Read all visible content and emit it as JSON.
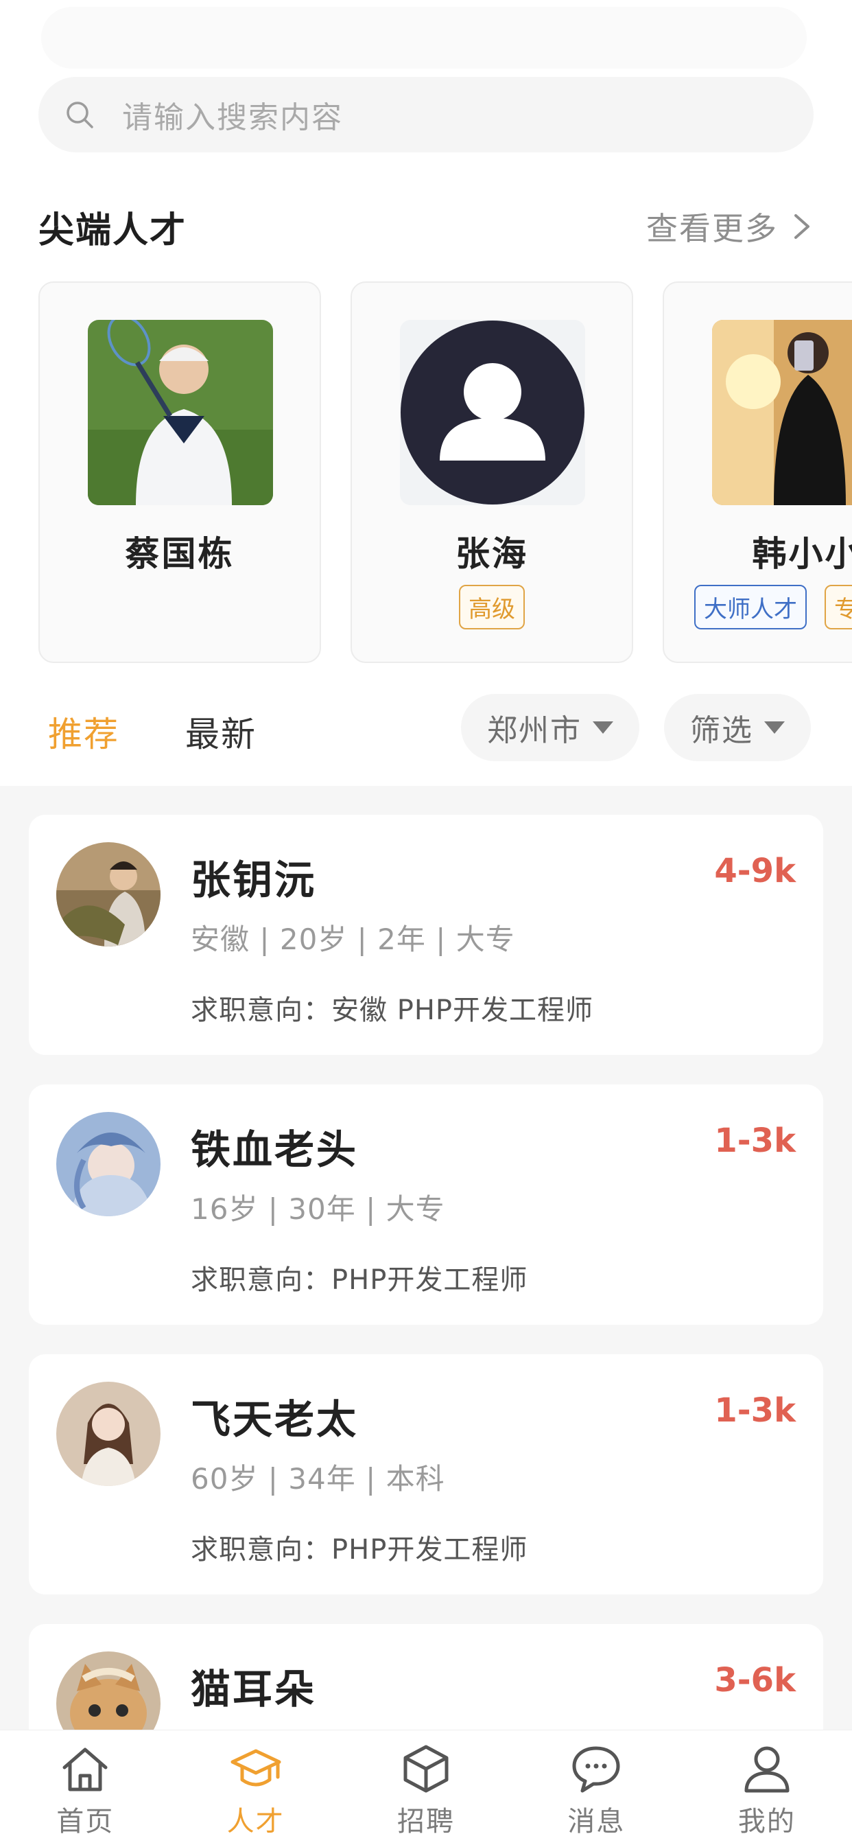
{
  "search": {
    "placeholder": "请输入搜索内容"
  },
  "talent_section": {
    "title": "尖端人才",
    "see_more": "查看更多",
    "cards": [
      {
        "name": "蔡国栋",
        "tags": []
      },
      {
        "name": "张海",
        "tags": [
          "高级"
        ]
      },
      {
        "name": "韩小小",
        "tags": [
          "大师人才",
          "专"
        ]
      }
    ]
  },
  "filters": {
    "tabs": [
      "推荐",
      "最新"
    ],
    "active_tab": "推荐",
    "city": "郑州市",
    "filter_label": "筛选"
  },
  "candidates": [
    {
      "name": "张钥沅",
      "salary": "4-9k",
      "meta": "安徽 | 20岁 | 2年 | 大专",
      "intent": "求职意向：安徽 PHP开发工程师"
    },
    {
      "name": "铁血老头",
      "salary": "1-3k",
      "meta": "16岁 | 30年 | 大专",
      "intent": "求职意向：PHP开发工程师"
    },
    {
      "name": "飞天老太",
      "salary": "1-3k",
      "meta": "60岁 | 34年 | 本科",
      "intent": "求职意向：PHP开发工程师"
    },
    {
      "name": "猫耳朵",
      "salary": "3-6k",
      "meta": "",
      "intent": ""
    }
  ],
  "tabbar": {
    "items": [
      {
        "label": "首页",
        "icon": "home-icon"
      },
      {
        "label": "人才",
        "icon": "graduation-cap-icon"
      },
      {
        "label": "招聘",
        "icon": "box-icon"
      },
      {
        "label": "消息",
        "icon": "chat-bubble-icon"
      },
      {
        "label": "我的",
        "icon": "user-icon"
      }
    ],
    "active": "人才"
  },
  "colors": {
    "accent": "#f0a030",
    "salary": "#e06152",
    "tag_gold": "#e09a2e",
    "tag_blue": "#3f6fc6"
  }
}
